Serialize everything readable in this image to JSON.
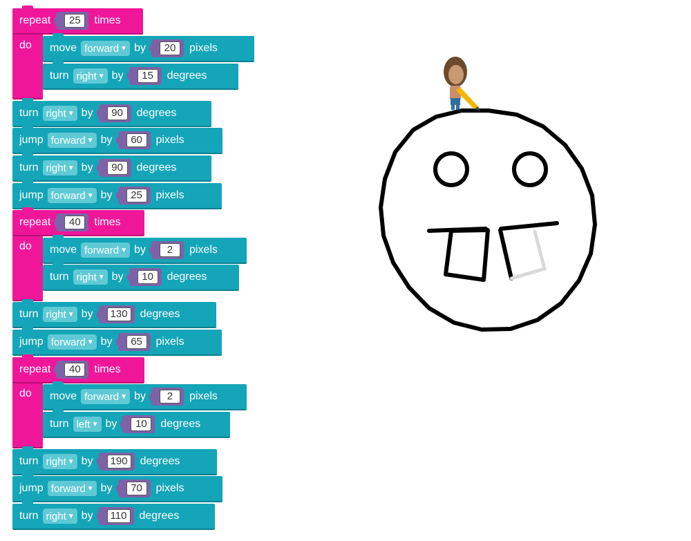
{
  "colors": {
    "motion_block": "#14a5b8",
    "loop_block": "#f0169a",
    "number_slot": "#7d62a8",
    "dropdown": "#5fcad6",
    "drawing_line": "#000000",
    "faded_line": "#d9d9d9"
  },
  "blocks": [
    {
      "kind": "repeat",
      "word1": "repeat",
      "value": "25",
      "word2": "times",
      "do": "do"
    },
    {
      "kind": "move",
      "word1": "move",
      "dir": "forward",
      "by": "by",
      "value": "20",
      "unit": "pixels"
    },
    {
      "kind": "turn",
      "word1": "turn",
      "dir": "right",
      "by": "by",
      "value": "15",
      "unit": "degrees"
    },
    {
      "kind": "turn",
      "word1": "turn",
      "dir": "right",
      "by": "by",
      "value": "90",
      "unit": "degrees"
    },
    {
      "kind": "jump",
      "word1": "jump",
      "dir": "forward",
      "by": "by",
      "value": "60",
      "unit": "pixels"
    },
    {
      "kind": "turn",
      "word1": "turn",
      "dir": "right",
      "by": "by",
      "value": "90",
      "unit": "degrees"
    },
    {
      "kind": "jump",
      "word1": "jump",
      "dir": "forward",
      "by": "by",
      "value": "25",
      "unit": "pixels"
    },
    {
      "kind": "repeat",
      "word1": "repeat",
      "value": "40",
      "word2": "times",
      "do": "do"
    },
    {
      "kind": "move",
      "word1": "move",
      "dir": "forward",
      "by": "by",
      "value": "2",
      "unit": "pixels"
    },
    {
      "kind": "turn",
      "word1": "turn",
      "dir": "right",
      "by": "by",
      "value": "10",
      "unit": "degrees"
    },
    {
      "kind": "turn",
      "word1": "turn",
      "dir": "right",
      "by": "by",
      "value": "130",
      "unit": "degrees"
    },
    {
      "kind": "jump",
      "word1": "jump",
      "dir": "forward",
      "by": "by",
      "value": "65",
      "unit": "pixels"
    },
    {
      "kind": "repeat",
      "word1": "repeat",
      "value": "40",
      "word2": "times",
      "do": "do"
    },
    {
      "kind": "move",
      "word1": "move",
      "dir": "forward",
      "by": "by",
      "value": "2",
      "unit": "pixels"
    },
    {
      "kind": "turn",
      "word1": "turn",
      "dir": "left",
      "by": "by",
      "value": "10",
      "unit": "degrees"
    },
    {
      "kind": "turn",
      "word1": "turn",
      "dir": "right",
      "by": "by",
      "value": "190",
      "unit": "degrees"
    },
    {
      "kind": "jump",
      "word1": "jump",
      "dir": "forward",
      "by": "by",
      "value": "70",
      "unit": "pixels"
    },
    {
      "kind": "turn",
      "word1": "turn",
      "dir": "right",
      "by": "by",
      "value": "110",
      "unit": "degrees"
    }
  ],
  "drawing": {
    "artist_icon": "artist-icon",
    "description_shape": "smiley-face-with-buck-teeth"
  }
}
